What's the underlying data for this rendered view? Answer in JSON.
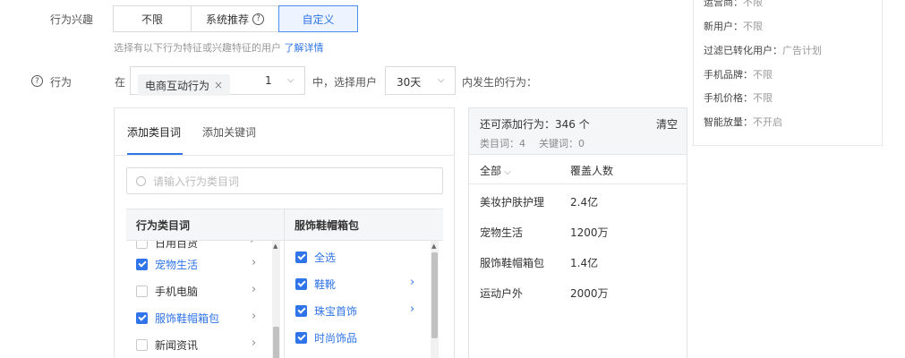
{
  "interest": {
    "label": "行为兴趣",
    "options": [
      "不限",
      "系统推荐",
      "自定义"
    ],
    "help_mark": "?",
    "hint": "选择有以下行为特征或兴趣特征的用户",
    "hint_link": "了解详情"
  },
  "behavior": {
    "help_mark": "?",
    "label": "行为",
    "in_text": "在",
    "tag": "电商互动行为",
    "tag_close": "×",
    "count": "1",
    "mid_text": "中，选择用户",
    "days": "30天",
    "tail_text": "内发生的行为："
  },
  "panel": {
    "tabs": [
      "添加类目词",
      "添加关键词"
    ],
    "search_placeholder": "请输入行为类目词",
    "left_header": "行为类目词",
    "right_header": "服饰鞋帽箱包",
    "left_items": [
      {
        "label": "日用百货",
        "checked": false
      },
      {
        "label": "宠物生活",
        "checked": true
      },
      {
        "label": "手机电脑",
        "checked": false
      },
      {
        "label": "服饰鞋帽箱包",
        "checked": true
      },
      {
        "label": "新闻资讯",
        "checked": false
      }
    ],
    "right_items": [
      {
        "label": "全选",
        "checked": true,
        "has_children": false
      },
      {
        "label": "鞋靴",
        "checked": true,
        "has_children": true
      },
      {
        "label": "珠宝首饰",
        "checked": true,
        "has_children": true
      },
      {
        "label": "时尚饰品",
        "checked": true,
        "has_children": false
      }
    ]
  },
  "summary": {
    "can_add_label": "还可添加行为：",
    "can_add_value": "346 个",
    "clear": "清空",
    "category_count": "类目词：4",
    "keyword_count": "关键词：0",
    "col_all": "全部",
    "col_coverage": "覆盖人数",
    "rows": [
      {
        "name": "美妆护肤护理",
        "value": "2.4亿"
      },
      {
        "name": "宠物生活",
        "value": "1200万"
      },
      {
        "name": "服饰鞋帽箱包",
        "value": "1.4亿"
      },
      {
        "name": "运动户外",
        "value": "2000万"
      }
    ]
  },
  "side_card": {
    "items": [
      {
        "key": "运营商：",
        "value": "不限"
      },
      {
        "key": "新用户：",
        "value": "不限"
      },
      {
        "key": "过滤已转化用户：",
        "value": "广告计划"
      },
      {
        "key": "手机品牌：",
        "value": "不限"
      },
      {
        "key": "手机价格：",
        "value": "不限"
      },
      {
        "key": "智能放量：",
        "value": "不开启"
      }
    ]
  },
  "colors": {
    "accent": "#2f74e8",
    "active_bg": "#eef4ff"
  }
}
